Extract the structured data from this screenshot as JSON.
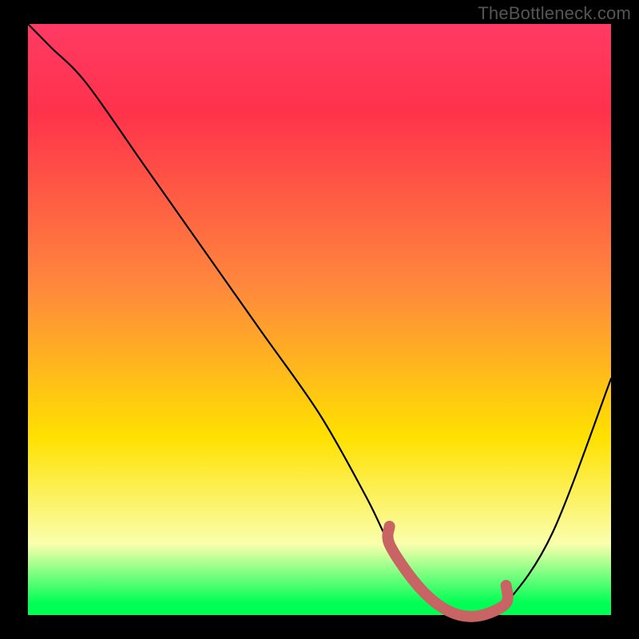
{
  "watermark": "TheBottleneck.com",
  "colors": {
    "black": "#000000",
    "curve": "#000000",
    "marker": "#c86464",
    "green": "#00ff55",
    "yellow_light": "#faffad",
    "yellow": "#ffe100",
    "orange": "#ff8a3c",
    "red": "#ff324b",
    "pink": "#ff3a64"
  },
  "chart_data": {
    "type": "line",
    "title": "",
    "xlabel": "",
    "ylabel": "",
    "xlim": [
      0,
      100
    ],
    "ylim": [
      0,
      100
    ],
    "x": [
      0,
      4,
      10,
      20,
      30,
      40,
      50,
      58,
      62,
      66,
      70,
      74,
      78,
      82,
      90,
      100
    ],
    "values": [
      100,
      96,
      90,
      76,
      62,
      48,
      34,
      20,
      12,
      6,
      2,
      0,
      0,
      2,
      14,
      40
    ],
    "marker_region": {
      "x_start": 62,
      "x_end": 82
    },
    "notes": "y is relative bottleneck % (0 at the flat minimum, 100 at top of chart). Curve descends steeply from top-left, reaches a flat near-zero plateau roughly between x≈62 and x≈82 (highlighted by the salmon marker), then rises again toward the right."
  }
}
